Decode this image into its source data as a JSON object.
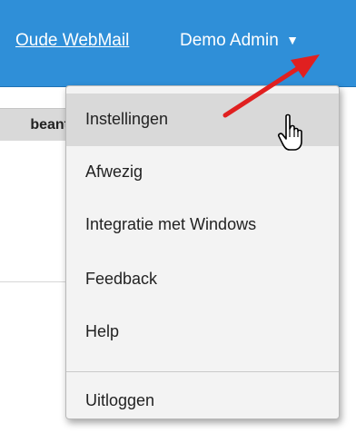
{
  "header": {
    "old_webmail_link": "Oude WebMail",
    "user_name": "Demo Admin",
    "caret": "▼"
  },
  "content": {
    "column_header_fragment": "beant"
  },
  "dropdown": {
    "items": [
      {
        "label": "Instellingen"
      },
      {
        "label": "Afwezig"
      },
      {
        "label": "Integratie met Windows"
      },
      {
        "label": "Feedback"
      },
      {
        "label": "Help"
      },
      {
        "label": "Uitloggen"
      }
    ]
  },
  "colors": {
    "header_blue": "#2f8fd8",
    "menu_bg": "#f3f3f3",
    "hover_bg": "#d9d9d9",
    "annotation_red": "#e02020"
  },
  "icons": {
    "cursor": "hand-pointer-icon",
    "annotation": "red-arrow-icon"
  }
}
